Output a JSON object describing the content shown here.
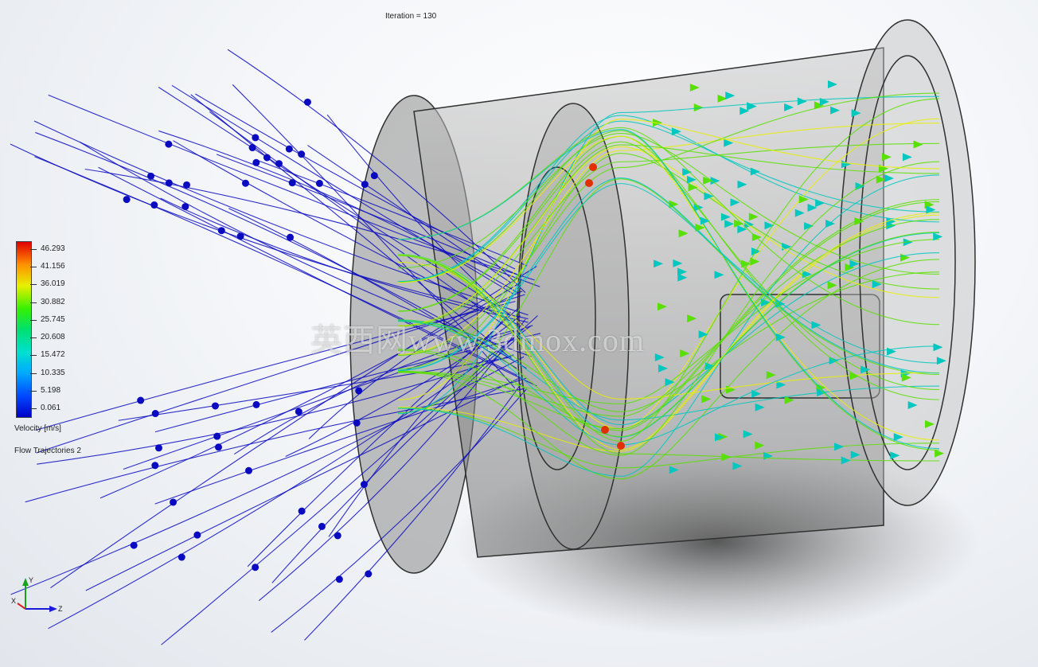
{
  "header": {
    "iteration": "Iteration = 130"
  },
  "legend": {
    "ticks": [
      "46.293",
      "41.156",
      "36.019",
      "30.882",
      "25.745",
      "20.608",
      "15.472",
      "10.335",
      "5.198",
      "0.061"
    ],
    "title": "Velocity [m/s]",
    "subtitle": "Flow Trajectories 2"
  },
  "triad": {
    "x": "X",
    "y": "Y",
    "z": "Z"
  },
  "watermark": "英西网www.3dmox.com",
  "colors": {
    "inlet": "#0a0ac0",
    "throat": "#58e000",
    "high": "#e03000",
    "outlet": "#00c8c0",
    "housing": "#7d7d7d"
  }
}
